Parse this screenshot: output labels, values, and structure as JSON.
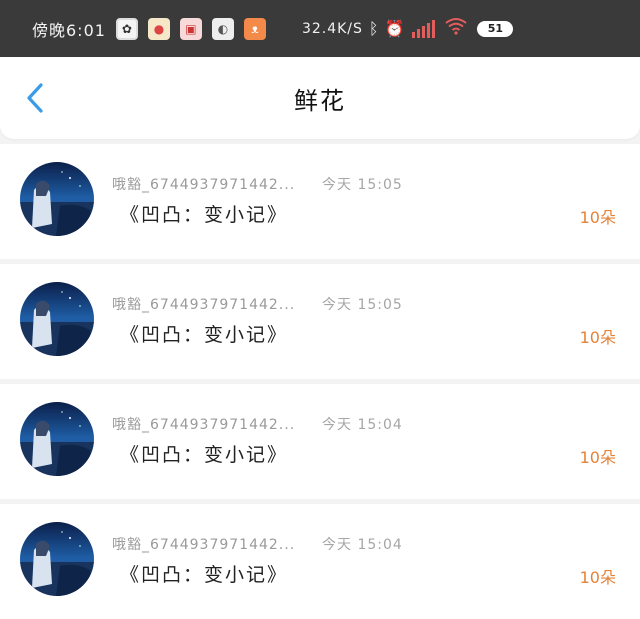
{
  "status_bar": {
    "time": "傍晚6:01",
    "net_speed": "32.4K/S",
    "battery": "51"
  },
  "nav": {
    "title": "鲜花"
  },
  "colors": {
    "accent_blue": "#3a9be8",
    "flower_count": "#e5823a"
  },
  "records": [
    {
      "username": "哦豁_6744937971442...",
      "time": "今天 15:05",
      "book": "《凹凸：变小记》",
      "flowers": "10朵"
    },
    {
      "username": "哦豁_6744937971442...",
      "time": "今天 15:05",
      "book": "《凹凸：变小记》",
      "flowers": "10朵"
    },
    {
      "username": "哦豁_6744937971442...",
      "time": "今天 15:04",
      "book": "《凹凸：变小记》",
      "flowers": "10朵"
    },
    {
      "username": "哦豁_6744937971442...",
      "time": "今天 15:04",
      "book": "《凹凸：变小记》",
      "flowers": "10朵"
    }
  ]
}
